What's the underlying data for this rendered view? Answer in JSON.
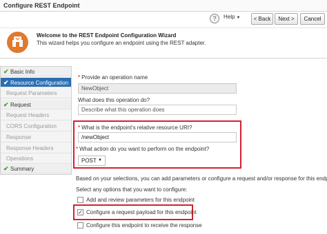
{
  "window": {
    "title": "Configure REST Endpoint"
  },
  "toolbar": {
    "help_label": "Help",
    "back_label": "< Back",
    "next_label": "Next >",
    "cancel_label": "Cancel"
  },
  "banner": {
    "title": "Welcome to the REST Endpoint Configuration Wizard",
    "description": "This wizard helps you configure an endpoint using the REST adapter.",
    "icon_color": "#e07a2c"
  },
  "nav": {
    "items": [
      {
        "label": "Basic Info",
        "state": "done"
      },
      {
        "label": "Resource Configuration",
        "state": "active"
      },
      {
        "label": "Request Parameters",
        "state": "disabled"
      },
      {
        "label": "Request",
        "state": "done"
      },
      {
        "label": "Request Headers",
        "state": "disabled"
      },
      {
        "label": "CORS Configuration",
        "state": "disabled"
      },
      {
        "label": "Response",
        "state": "disabled"
      },
      {
        "label": "Response Headers",
        "state": "disabled"
      },
      {
        "label": "Operations",
        "state": "disabled"
      },
      {
        "label": "Summary",
        "state": "done"
      }
    ],
    "active_color": "#2a6fb5"
  },
  "form": {
    "operation_name_label": "Provide an operation name",
    "operation_name_value": "NewObject",
    "operation_desc_label": "What does this operation do?",
    "operation_desc_placeholder": "Describe what this operation does",
    "resource_uri_label": "What is the endpoint's relative resource URI?",
    "resource_uri_value": "/newObject",
    "action_label": "What action do you want to perform on the endpoint?",
    "action_value": "POST",
    "selections_text": "Based on your selections, you can add parameters or configure a request and/or response for this endpoint.",
    "options_label": "Select any options that you want to configure:",
    "options": [
      {
        "label": "Add and review parameters for this endpoint",
        "checked": false
      },
      {
        "label": "Configure a request payload for this endpoint",
        "checked": true
      },
      {
        "label": "Configure this endpoint to receive the response",
        "checked": false
      }
    ],
    "highlight_color": "#d3202e"
  }
}
